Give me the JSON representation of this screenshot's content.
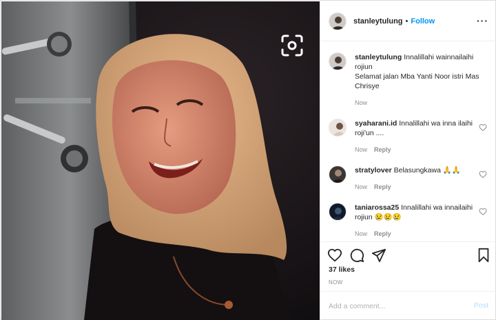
{
  "post": {
    "username": "stanleytulung",
    "follow_label": "Follow",
    "dot": "•",
    "more_label": "···",
    "caption_line1": "Innalillahi wainnailaihi rojiun",
    "caption_line2": "Selamat jalan Mba Yanti Noor istri Mas Chrisye",
    "caption_time": "Now"
  },
  "comments": [
    {
      "username": "syaharani.id",
      "text": "Innalillahi wa inna ilaihi roji'un ....",
      "time": "Now",
      "reply": "Reply"
    },
    {
      "username": "stratylover",
      "text": "Belasungkawa 🙏🙏",
      "time": "Now",
      "reply": "Reply"
    },
    {
      "username": "taniarossa25",
      "text": "Innalillahi wa innailaihi rojiun 😢😢😢",
      "time": "Now",
      "reply": "Reply"
    }
  ],
  "footer": {
    "likes": "37 likes",
    "timestamp": "NOW",
    "add_comment_placeholder": "Add a comment...",
    "post_label": "Post"
  },
  "colors": {
    "link": "#0095f6",
    "muted": "#8e8e8e",
    "post_disabled": "#b3dbff"
  },
  "icons": [
    "scan-icon",
    "more-icon",
    "heart-icon",
    "comment-icon",
    "share-icon",
    "bookmark-icon"
  ]
}
